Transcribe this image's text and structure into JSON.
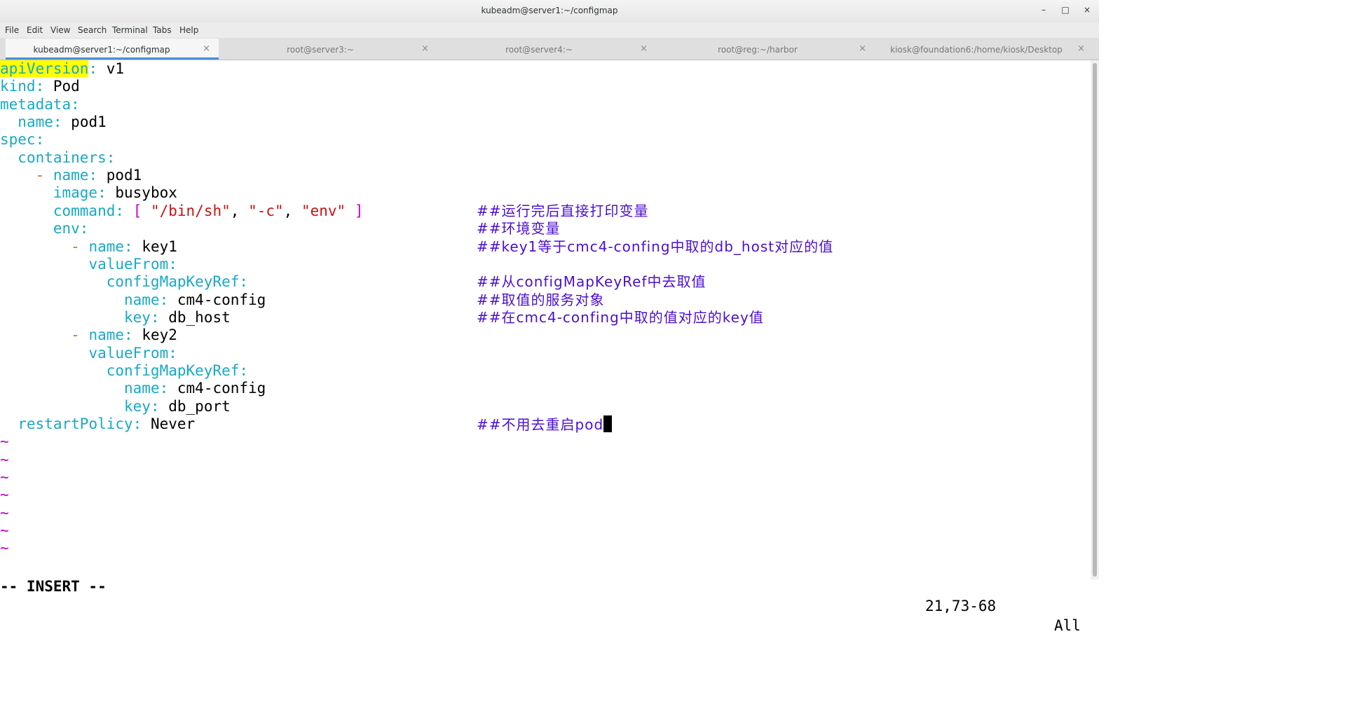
{
  "window": {
    "title": "kubeadm@server1:~/configmap",
    "minimize": "–",
    "maximize": "□",
    "close": "×"
  },
  "menu": [
    "File",
    "Edit",
    "View",
    "Search",
    "Terminal",
    "Tabs",
    "Help"
  ],
  "tabs": [
    {
      "label": "kubeadm@server1:~/configmap",
      "close": "×"
    },
    {
      "label": "root@server3:~",
      "close": "×"
    },
    {
      "label": "root@server4:~",
      "close": "×"
    },
    {
      "label": "root@reg:~/harbor",
      "close": "×"
    },
    {
      "label": "kiosk@foundation6:/home/kiosk/Desktop",
      "close": "×"
    }
  ],
  "editor": {
    "code": [
      {
        "indent": "",
        "dash": "",
        "key": "apiVersion",
        "colon": ":",
        "value": " v1"
      },
      {
        "indent": "",
        "dash": "",
        "key": "kind",
        "colon": ":",
        "value": " Pod"
      },
      {
        "indent": "",
        "dash": "",
        "key": "metadata",
        "colon": ":",
        "value": ""
      },
      {
        "indent": "  ",
        "dash": "",
        "key": "name",
        "colon": ":",
        "value": " pod1"
      },
      {
        "indent": "",
        "dash": "",
        "key": "spec",
        "colon": ":",
        "value": ""
      },
      {
        "indent": "  ",
        "dash": "",
        "key": "containers",
        "colon": ":",
        "value": ""
      },
      {
        "indent": "    ",
        "dash": "- ",
        "key": "name",
        "colon": ":",
        "value": " pod1"
      },
      {
        "indent": "      ",
        "dash": "",
        "key": "image",
        "colon": ":",
        "value": " busybox"
      },
      {
        "indent": "      ",
        "dash": "",
        "key": "command",
        "colon": ":",
        "value": ""
      },
      {
        "indent": "      ",
        "dash": "",
        "key": "env",
        "colon": ":",
        "value": ""
      },
      {
        "indent": "        ",
        "dash": "- ",
        "key": "name",
        "colon": ":",
        "value": " key1"
      },
      {
        "indent": "          ",
        "dash": "",
        "key": "valueFrom",
        "colon": ":",
        "value": ""
      },
      {
        "indent": "            ",
        "dash": "",
        "key": "configMapKeyRef",
        "colon": ":",
        "value": ""
      },
      {
        "indent": "              ",
        "dash": "",
        "key": "name",
        "colon": ":",
        "value": " cm4-config"
      },
      {
        "indent": "              ",
        "dash": "",
        "key": "key",
        "colon": ":",
        "value": " db_host"
      },
      {
        "indent": "        ",
        "dash": "- ",
        "key": "name",
        "colon": ":",
        "value": " key2"
      },
      {
        "indent": "          ",
        "dash": "",
        "key": "valueFrom",
        "colon": ":",
        "value": ""
      },
      {
        "indent": "            ",
        "dash": "",
        "key": "configMapKeyRef",
        "colon": ":",
        "value": ""
      },
      {
        "indent": "              ",
        "dash": "",
        "key": "name",
        "colon": ":",
        "value": " cm4-config"
      },
      {
        "indent": "              ",
        "dash": "",
        "key": "key",
        "colon": ":",
        "value": " db_port"
      },
      {
        "indent": "  ",
        "dash": "",
        "key": "restartPolicy",
        "colon": ":",
        "value": " Never"
      }
    ],
    "command_parts": {
      "open": "[ ",
      "a1": "\"/bin/sh\"",
      "sep1": ", ",
      "a2": "\"-c\"",
      "sep2": ", ",
      "a3": "\"env\"",
      "close": " ]"
    },
    "comments": [
      {
        "line": 8,
        "text": "##运行完后直接打印变量"
      },
      {
        "line": 9,
        "text": "##环境变量"
      },
      {
        "line": 10,
        "text": "##key1等于cmc4-confing中取的db_host对应的值"
      },
      {
        "line": 12,
        "text": "##从configMapKeyRef中去取值"
      },
      {
        "line": 13,
        "text": "##取值的服务对象"
      },
      {
        "line": 14,
        "text": "##在cmc4-confing中取的值对应的key值"
      },
      {
        "line": 20,
        "text": "##不用去重启pod"
      }
    ],
    "tilde": "~",
    "tilde_count": 7
  },
  "status": {
    "mode": "-- INSERT --",
    "position": "21,73-68",
    "range": "All"
  },
  "colors": {
    "key": "#17a9c6",
    "string": "#c81212",
    "bracket": "#c300c3",
    "comment": "#4b0fd2",
    "dash": "#d2691e",
    "highlight": "#ffff00",
    "tab_accent": "#4a90d9"
  }
}
